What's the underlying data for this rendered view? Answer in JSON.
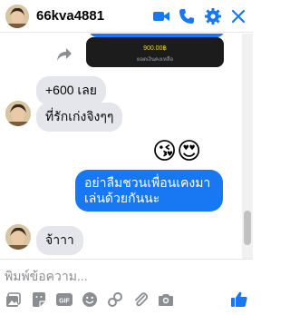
{
  "header": {
    "contact_name": "66kva4881",
    "icons": [
      "video-call-icon",
      "phone-icon",
      "gear-icon",
      "close-icon"
    ]
  },
  "messages": {
    "image_card": {
      "amount": "900.00฿",
      "caption": "ยอดเงินคงเหลือ"
    },
    "msg1": "+600 เลย",
    "msg2": "ที่รักเก่งจิงๆๆ",
    "emoji_reply": "😘😍",
    "msg3_line1": "อย่าลืมชวนเพื่อนเคงมา",
    "msg3_line2": "เล่นด้วยกันนะ",
    "msg4": "จ้าาา"
  },
  "composer": {
    "placeholder": "พิมพ์ข้อความ...",
    "tools": [
      "photo-icon",
      "gif-sticker-icon",
      "gif-icon",
      "emoji-icon",
      "game-icon",
      "attach-icon",
      "camera-icon",
      "like-icon"
    ]
  },
  "colors": {
    "accent": "#1877f2",
    "bubble_incoming": "#e4e6eb",
    "text": "#050505",
    "placeholder": "#8a8d91"
  }
}
